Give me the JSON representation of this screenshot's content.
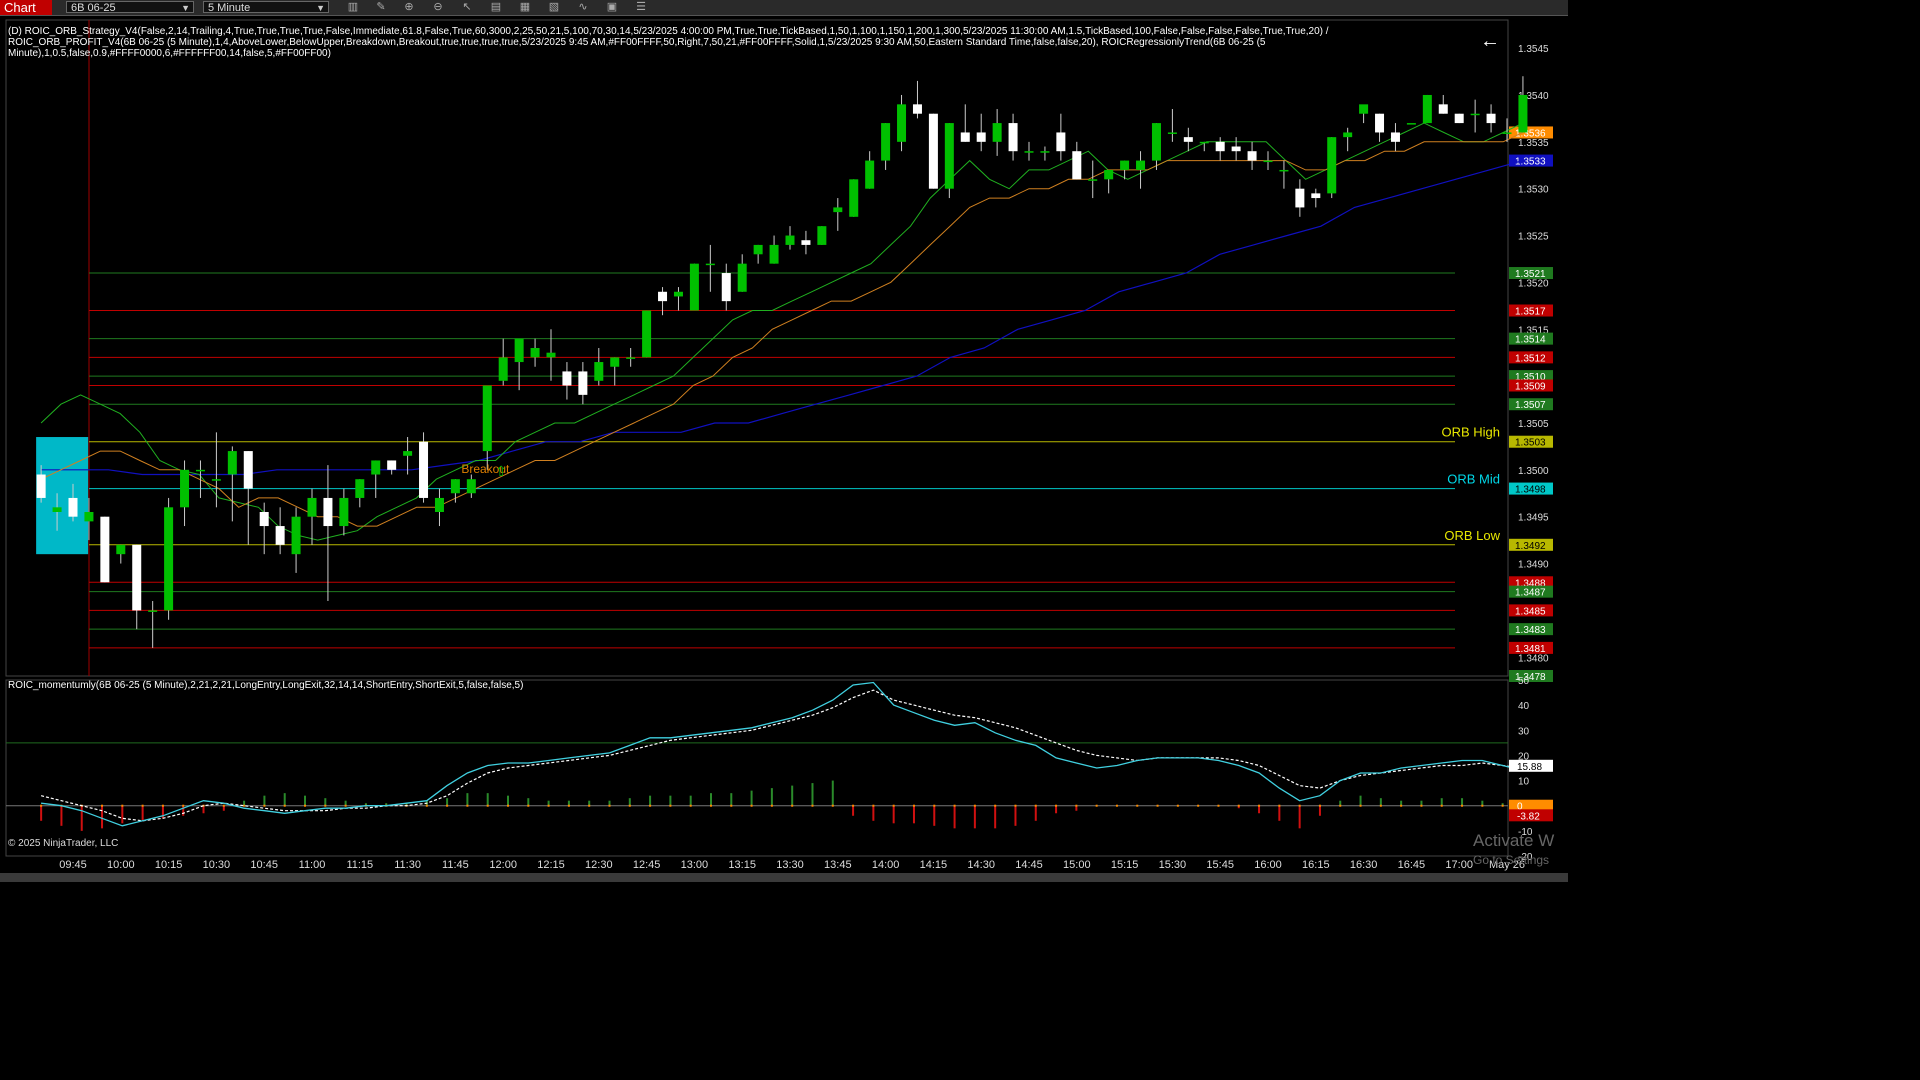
{
  "toolbar": {
    "chart_tab": "Chart",
    "instrument": "6B 06-25",
    "interval": "5 Minute",
    "tools": [
      "bars-icon",
      "pencil-icon",
      "zoom-in-icon",
      "zoom-out-icon",
      "pointer-icon",
      "properties-icon",
      "templates-icon",
      "data-box-icon",
      "indicators-icon",
      "strategies-icon",
      "drawing-tools-icon",
      "menu-icon"
    ]
  },
  "strategy_title": [
    "(D) ROIC_ORB_Strategy_V4(False,2,14,Trailing,4,True,True,True,True,False,Immediate,61.8,False,True,60,3000,2,25,50,21,5,100,70,30,14,5/23/2025 4:00:00 PM,True,True,TickBased,1,50,1,100,1,150,1,200,1,300,5/23/2025 11:30:00 AM,1.5,TickBased,100,False,False,False,False,True,True,20) /",
    "ROIC_ORB_PROFIT_V4(6B 06-25 (5 Minute),1,4,AboveLower,BelowUpper,Breakdown,Breakout,true,true,true,true,5/23/2025 9:45 AM,#FF00FFFF,50,Right,7,50,21,#FF00FFFF,Solid,1,5/23/2025 9:30 AM,50,Eastern Standard Time,false,false,20), ROICRegressionlyTrend(6B 06-25 (5",
    "Minute),1,0.5,false,0.9,#FFFF0000,6,#FFFFFF00,14,false,5,#FF00FF00)"
  ],
  "indicator_title": "ROIC_momentumly(6B 06-25 (5 Minute),2,21,2,21,LongEntry,LongExit,32,14,14,ShortEntry,ShortExit,5,false,false,5)",
  "copyright": "© 2025 NinjaTrader, LLC",
  "watermark": [
    "Activate W",
    "Go to Settings"
  ],
  "colors": {
    "up_candle": "#00c000",
    "down_candle": "#ffffff",
    "grid": "#1a1a1a",
    "orb_line": "#b8b800",
    "orb_mid": "#00c8c8",
    "red_line": "#c00000",
    "green_line": "#1f7a1f",
    "ema_fast": "#20b020",
    "ema_slow": "#d08020",
    "trend": "#1010c0",
    "osc_main": "#40d0e0",
    "osc_signal": "#ffffff"
  },
  "chart_data": {
    "type": "candlestick",
    "instrument": "6B 06-25",
    "interval": "5 Minute",
    "ylim": [
      1.3478,
      1.3548
    ],
    "y_ticks": [
      "1.3545",
      "1.3540",
      "1.3535",
      "1.3530",
      "1.3525",
      "1.3520",
      "1.3515",
      "1.3510",
      "1.3505",
      "1.3500",
      "1.3495",
      "1.3490",
      "1.3485",
      "1.3480"
    ],
    "x_ticks": [
      "09:45",
      "10:00",
      "10:15",
      "10:30",
      "10:45",
      "11:00",
      "11:15",
      "11:30",
      "11:45",
      "12:00",
      "12:15",
      "12:30",
      "12:45",
      "13:00",
      "13:15",
      "13:30",
      "13:45",
      "14:00",
      "14:15",
      "14:30",
      "14:45",
      "15:00",
      "15:15",
      "15:30",
      "15:45",
      "16:00",
      "16:15",
      "16:30",
      "16:45",
      "17:00",
      "May 26"
    ],
    "x_tick_start": "09:45",
    "x_tick_step_min": 15,
    "first_bar": "09:35",
    "bar_minutes": 5,
    "candles": [
      [
        1.34995,
        1.35005,
        1.34965,
        1.3497
      ],
      [
        1.34955,
        1.34975,
        1.34935,
        1.3496
      ],
      [
        1.3497,
        1.34985,
        1.34945,
        1.3495
      ],
      [
        1.34945,
        1.3497,
        1.34925,
        1.34955
      ],
      [
        1.3495,
        1.3495,
        1.3488,
        1.3488
      ],
      [
        1.3491,
        1.3492,
        1.349,
        1.3492
      ],
      [
        1.3492,
        1.3492,
        1.3483,
        1.3485
      ],
      [
        1.3485,
        1.3486,
        1.3481,
        1.3485
      ],
      [
        1.3485,
        1.3497,
        1.3484,
        1.3496
      ],
      [
        1.3496,
        1.3501,
        1.3494,
        1.35
      ],
      [
        1.35,
        1.3501,
        1.3497,
        1.35
      ],
      [
        1.3499,
        1.3504,
        1.3496,
        1.3499
      ],
      [
        1.34995,
        1.35025,
        1.34945,
        1.3502
      ],
      [
        1.3502,
        1.3502,
        1.3492,
        1.3498
      ],
      [
        1.34955,
        1.34965,
        1.3491,
        1.3494
      ],
      [
        1.3494,
        1.3496,
        1.3491,
        1.3492
      ],
      [
        1.3491,
        1.3496,
        1.3489,
        1.3495
      ],
      [
        1.3495,
        1.3498,
        1.3492,
        1.3497
      ],
      [
        1.3497,
        1.35005,
        1.3486,
        1.3494
      ],
      [
        1.3494,
        1.3498,
        1.3493,
        1.3497
      ],
      [
        1.3497,
        1.3499,
        1.3496,
        1.3499
      ],
      [
        1.34995,
        1.3501,
        1.3497,
        1.3501
      ],
      [
        1.3501,
        1.3501,
        1.34995,
        1.35
      ],
      [
        1.35015,
        1.35035,
        1.34995,
        1.3502
      ],
      [
        1.3503,
        1.3504,
        1.34965,
        1.3497
      ],
      [
        1.34955,
        1.3498,
        1.3494,
        1.3497
      ],
      [
        1.34975,
        1.3499,
        1.34965,
        1.3499
      ],
      [
        1.34975,
        1.34995,
        1.3497,
        1.3499
      ],
      [
        1.3502,
        1.3509,
        1.35,
        1.3509
      ],
      [
        1.35095,
        1.3514,
        1.3509,
        1.3512
      ],
      [
        1.35115,
        1.35135,
        1.35085,
        1.3514
      ],
      [
        1.3512,
        1.3514,
        1.3511,
        1.3513
      ],
      [
        1.3512,
        1.3515,
        1.35095,
        1.35125
      ],
      [
        1.35105,
        1.35115,
        1.35075,
        1.3509
      ],
      [
        1.35105,
        1.35115,
        1.3507,
        1.3508
      ],
      [
        1.35095,
        1.3513,
        1.3509,
        1.35115
      ],
      [
        1.3511,
        1.3512,
        1.3509,
        1.3512
      ],
      [
        1.3512,
        1.3513,
        1.3511,
        1.3512
      ],
      [
        1.3512,
        1.3517,
        1.3512,
        1.3517
      ],
      [
        1.3519,
        1.35195,
        1.35165,
        1.3518
      ],
      [
        1.35185,
        1.35195,
        1.3517,
        1.3519
      ],
      [
        1.3517,
        1.3522,
        1.3517,
        1.3522
      ],
      [
        1.3522,
        1.3524,
        1.3519,
        1.3522
      ],
      [
        1.3521,
        1.3522,
        1.3517,
        1.3518
      ],
      [
        1.3519,
        1.3523,
        1.3519,
        1.3522
      ],
      [
        1.3523,
        1.3524,
        1.3522,
        1.3524
      ],
      [
        1.3522,
        1.3525,
        1.3522,
        1.3524
      ],
      [
        1.3524,
        1.3526,
        1.35235,
        1.3525
      ],
      [
        1.35245,
        1.35255,
        1.3523,
        1.3524
      ],
      [
        1.3524,
        1.3526,
        1.3524,
        1.3526
      ],
      [
        1.35275,
        1.3529,
        1.35255,
        1.3528
      ],
      [
        1.3527,
        1.3531,
        1.3527,
        1.3531
      ],
      [
        1.353,
        1.3534,
        1.353,
        1.3533
      ],
      [
        1.3533,
        1.3537,
        1.3532,
        1.3537
      ],
      [
        1.3535,
        1.354,
        1.3534,
        1.3539
      ],
      [
        1.3539,
        1.35415,
        1.35375,
        1.3538
      ],
      [
        1.3538,
        1.3538,
        1.353,
        1.353
      ],
      [
        1.353,
        1.3537,
        1.3529,
        1.3537
      ],
      [
        1.3536,
        1.3539,
        1.3535,
        1.3535
      ],
      [
        1.3536,
        1.3538,
        1.3534,
        1.3535
      ],
      [
        1.3535,
        1.35385,
        1.35335,
        1.3537
      ],
      [
        1.3537,
        1.3538,
        1.3533,
        1.3534
      ],
      [
        1.3534,
        1.3535,
        1.3533,
        1.3534
      ],
      [
        1.3534,
        1.35345,
        1.3533,
        1.3534
      ],
      [
        1.3536,
        1.3538,
        1.3533,
        1.3534
      ],
      [
        1.3534,
        1.3535,
        1.3531,
        1.3531
      ],
      [
        1.3531,
        1.3533,
        1.3529,
        1.3531
      ],
      [
        1.3531,
        1.3532,
        1.35295,
        1.3532
      ],
      [
        1.3532,
        1.3533,
        1.3531,
        1.3533
      ],
      [
        1.3532,
        1.3534,
        1.353,
        1.3533
      ],
      [
        1.3533,
        1.3537,
        1.3532,
        1.3537
      ],
      [
        1.3536,
        1.35385,
        1.3535,
        1.3536
      ],
      [
        1.35355,
        1.35365,
        1.3534,
        1.3535
      ],
      [
        1.3535,
        1.3535,
        1.3534,
        1.3535
      ],
      [
        1.3535,
        1.35355,
        1.3533,
        1.3534
      ],
      [
        1.35345,
        1.35355,
        1.3533,
        1.3534
      ],
      [
        1.3534,
        1.3535,
        1.3532,
        1.3533
      ],
      [
        1.3533,
        1.3534,
        1.3532,
        1.3533
      ],
      [
        1.3532,
        1.3533,
        1.353,
        1.3532
      ],
      [
        1.353,
        1.3531,
        1.3527,
        1.3528
      ],
      [
        1.35295,
        1.353,
        1.3528,
        1.3529
      ],
      [
        1.35295,
        1.35355,
        1.3529,
        1.35355
      ],
      [
        1.35355,
        1.35365,
        1.3534,
        1.3536
      ],
      [
        1.3538,
        1.35385,
        1.3537,
        1.3539
      ],
      [
        1.3538,
        1.3538,
        1.3535,
        1.3536
      ],
      [
        1.3536,
        1.3537,
        1.3534,
        1.3535
      ],
      [
        1.3537,
        1.3537,
        1.3537,
        1.3537
      ],
      [
        1.3537,
        1.354,
        1.3537,
        1.354
      ],
      [
        1.3539,
        1.354,
        1.3538,
        1.3538
      ],
      [
        1.3538,
        1.3538,
        1.3537,
        1.3537
      ],
      [
        1.3538,
        1.35395,
        1.3536,
        1.3538
      ],
      [
        1.3538,
        1.3539,
        1.3536,
        1.3537
      ],
      [
        1.3536,
        1.35375,
        1.3535,
        1.3536
      ],
      [
        1.3536,
        1.3542,
        1.3536,
        1.354
      ]
    ],
    "ema_fast": [
      1.3505,
      1.3507,
      1.3508,
      1.3507,
      1.3506,
      1.3504,
      1.3501,
      1.35,
      1.34995,
      1.3497,
      1.34965,
      1.3496,
      1.3494,
      1.3493,
      1.34925,
      1.3493,
      1.34935,
      1.3495,
      1.3496,
      1.3497,
      1.3499,
      1.35,
      1.3501,
      1.3501,
      1.3503,
      1.3504,
      1.3505,
      1.3505,
      1.3506,
      1.3507,
      1.3508,
      1.3509,
      1.351,
      1.3512,
      1.3514,
      1.3516,
      1.3517,
      1.3517,
      1.3518,
      1.3519,
      1.352,
      1.3521,
      1.3522,
      1.3524,
      1.3526,
      1.3529,
      1.3531,
      1.3533,
      1.3531,
      1.353,
      1.3532,
      1.3532,
      1.3533,
      1.3534,
      1.3532,
      1.3531,
      1.3532,
      1.3533,
      1.3534,
      1.3535,
      1.3535,
      1.3535,
      1.3535,
      1.3533,
      1.3531,
      1.3532,
      1.3533,
      1.3534,
      1.3535,
      1.3536,
      1.3537,
      1.3536,
      1.3535,
      1.3535,
      1.3536,
      1.3537
    ],
    "ema_fast_start_index": 0,
    "ema_slow": [
      1.3499,
      1.35,
      1.3501,
      1.3502,
      1.3502,
      1.3501,
      1.35,
      1.35,
      1.3499,
      1.3498,
      1.3496,
      1.3497,
      1.3497,
      1.3496,
      1.3495,
      1.3495,
      1.3494,
      1.3494,
      1.3495,
      1.3496,
      1.3496,
      1.3497,
      1.3498,
      1.3499,
      1.35,
      1.3501,
      1.3501,
      1.3502,
      1.3503,
      1.3504,
      1.3505,
      1.3506,
      1.3507,
      1.3509,
      1.351,
      1.3512,
      1.3513,
      1.3515,
      1.3516,
      1.3517,
      1.3518,
      1.3518,
      1.3519,
      1.352,
      1.3522,
      1.3524,
      1.3526,
      1.3528,
      1.3529,
      1.3529,
      1.353,
      1.353,
      1.3531,
      1.3531,
      1.3532,
      1.3532,
      1.3532,
      1.3533,
      1.3533,
      1.3533,
      1.3533,
      1.3533,
      1.3533,
      1.3533,
      1.3532,
      1.3532,
      1.3533,
      1.3533,
      1.3534,
      1.3534,
      1.3535,
      1.3535,
      1.3535,
      1.3535,
      1.3535,
      1.3536
    ],
    "trend_line": [
      1.35,
      1.35,
      1.35,
      1.34995,
      1.34995,
      1.34995,
      1.34995,
      1.35,
      1.35,
      1.35,
      1.35,
      1.35,
      1.35005,
      1.3501,
      1.3502,
      1.3503,
      1.3503,
      1.3504,
      1.3504,
      1.3504,
      1.3505,
      1.3505,
      1.3506,
      1.3507,
      1.3508,
      1.3509,
      1.351,
      1.3512,
      1.3513,
      1.3515,
      1.3516,
      1.3517,
      1.3519,
      1.352,
      1.3521,
      1.3523,
      1.3524,
      1.3525,
      1.3526,
      1.3528,
      1.3529,
      1.353,
      1.3531,
      1.3532,
      1.3533
    ],
    "levels": [
      {
        "label": "ORB High",
        "value": 1.3503,
        "color": "#b8b800",
        "tag": "1.3503"
      },
      {
        "label": "ORB Mid",
        "value": 1.3498,
        "color": "#00c8c8",
        "tag": "1.3498"
      },
      {
        "label": "ORB Low",
        "value": 1.3492,
        "color": "#b8b800",
        "tag": "1.3492"
      },
      {
        "label": "",
        "value": 1.3521,
        "color": "#1f7a1f",
        "tag": "1.3521"
      },
      {
        "label": "",
        "value": 1.3517,
        "color": "#c00000",
        "tag": "1.3517"
      },
      {
        "label": "",
        "value": 1.3514,
        "color": "#1f7a1f",
        "tag": "1.3514"
      },
      {
        "label": "",
        "value": 1.3512,
        "color": "#c00000",
        "tag": "1.3512"
      },
      {
        "label": "",
        "value": 1.351,
        "color": "#1f7a1f",
        "tag": "1.3510"
      },
      {
        "label": "",
        "value": 1.3509,
        "color": "#c00000",
        "tag": "1.3509"
      },
      {
        "label": "",
        "value": 1.3507,
        "color": "#1f7a1f",
        "tag": "1.3507"
      },
      {
        "label": "",
        "value": 1.3488,
        "color": "#c00000",
        "tag": "1.3488"
      },
      {
        "label": "",
        "value": 1.3487,
        "color": "#1f7a1f",
        "tag": "1.3487"
      },
      {
        "label": "",
        "value": 1.3485,
        "color": "#c00000",
        "tag": "1.3485"
      },
      {
        "label": "",
        "value": 1.3483,
        "color": "#1f7a1f",
        "tag": "1.3483"
      },
      {
        "label": "",
        "value": 1.3481,
        "color": "#c00000",
        "tag": "1.3481"
      }
    ],
    "price_tags": [
      {
        "value": 1.3536,
        "text": "1.3536",
        "color": "#ff8c00"
      },
      {
        "value": 1.3533,
        "text": "1.3533",
        "color": "#1010c0"
      },
      {
        "value": 1.3478,
        "text": "1.3478",
        "color": "#1f7a1f"
      }
    ],
    "annotation": {
      "text": "Breakout",
      "bar_index": 27,
      "value": 1.35
    }
  },
  "oscillator": {
    "ylim": [
      -20,
      50
    ],
    "y_ticks": [
      "50",
      "40",
      "30",
      "20",
      "10",
      "0",
      "-10",
      "-20"
    ],
    "level_line": 25,
    "current_tags": [
      {
        "value": 15.88,
        "text": "15.88",
        "color": "#ffffff"
      },
      {
        "value": 0,
        "text": "0",
        "color": "#ff8c00"
      },
      {
        "value": -3.82,
        "text": "-3.82",
        "color": "#c00000"
      }
    ],
    "main": [
      1,
      0,
      -2,
      -5,
      -8,
      -6,
      -4,
      -1,
      2,
      1,
      -1,
      -2,
      -3,
      -2,
      -1,
      -1,
      0,
      0,
      1,
      2,
      8,
      13,
      16,
      17,
      17,
      18,
      19,
      20,
      21,
      24,
      27,
      27,
      28,
      29,
      30,
      31,
      33,
      35,
      38,
      42,
      48,
      49,
      40,
      37,
      34,
      32,
      33,
      29,
      26,
      24,
      19,
      17,
      15,
      16,
      18,
      19,
      19,
      19,
      18,
      16,
      13,
      7,
      2,
      4,
      10,
      13,
      13,
      15,
      16,
      17,
      18,
      18,
      16,
      14
    ],
    "signal": [
      4,
      2,
      0,
      -2,
      -5,
      -6,
      -5,
      -3,
      0,
      1,
      0,
      -1,
      -2,
      -2,
      -2,
      -1,
      -1,
      0,
      0,
      1,
      4,
      9,
      13,
      15,
      16,
      17,
      18,
      19,
      20,
      22,
      24,
      26,
      27,
      28,
      29,
      30,
      32,
      34,
      36,
      39,
      43,
      46,
      42,
      40,
      38,
      36,
      35,
      33,
      31,
      28,
      25,
      22,
      20,
      19,
      18,
      19,
      19,
      19,
      19,
      18,
      16,
      12,
      8,
      7,
      10,
      12,
      13,
      14,
      15,
      16,
      16,
      17,
      16,
      15
    ],
    "histogram": [
      -6,
      -8,
      -10,
      -9,
      -7,
      -6,
      -5,
      -4,
      -3,
      -2,
      2,
      4,
      5,
      4,
      3,
      2,
      1,
      1,
      1,
      2,
      3,
      5,
      5,
      4,
      3,
      2,
      2,
      2,
      2,
      3,
      4,
      4,
      4,
      5,
      5,
      6,
      7,
      8,
      9,
      10,
      -4,
      -6,
      -7,
      -7,
      -8,
      -9,
      -9,
      -9,
      -8,
      -6,
      -3,
      -2,
      0,
      0,
      0,
      0,
      0,
      0,
      0,
      -1,
      -3,
      -6,
      -9,
      -4,
      2,
      4,
      3,
      2,
      2,
      3,
      3,
      2,
      1,
      -1
    ]
  }
}
